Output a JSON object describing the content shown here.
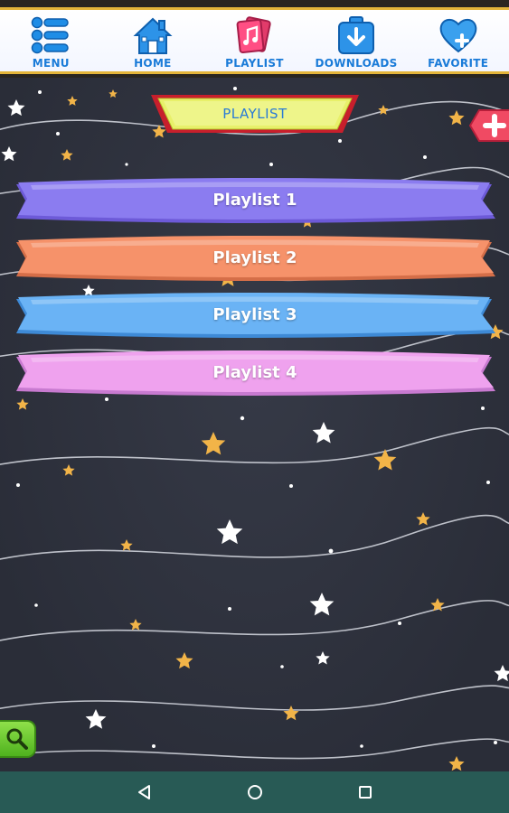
{
  "nav": {
    "items": [
      {
        "label": "MENU",
        "icon": "menu-icon"
      },
      {
        "label": "HOME",
        "icon": "home-icon"
      },
      {
        "label": "PLAYLIST",
        "icon": "playlist-icon"
      },
      {
        "label": "DOWNLOADS",
        "icon": "downloads-icon"
      },
      {
        "label": "FAVORITE",
        "icon": "favorite-icon"
      }
    ]
  },
  "header": {
    "title": "PLAYLIST"
  },
  "add_button": {
    "icon": "plus-icon"
  },
  "playlists": [
    {
      "label": "Playlist 1",
      "color": "#8b7cf0"
    },
    {
      "label": "Playlist 2",
      "color": "#f6926a"
    },
    {
      "label": "Playlist 3",
      "color": "#6ab3f5"
    },
    {
      "label": "Playlist 4",
      "color": "#efa2ee"
    }
  ],
  "search_button": {
    "icon": "search-icon"
  },
  "system_nav": {
    "icons": [
      "back-icon",
      "home-circle-icon",
      "recents-icon"
    ]
  },
  "colors": {
    "accent_gold": "#e4b53a",
    "nav_label": "#1a7bd8",
    "background": "#2f3340",
    "system_bar": "#285a55"
  }
}
